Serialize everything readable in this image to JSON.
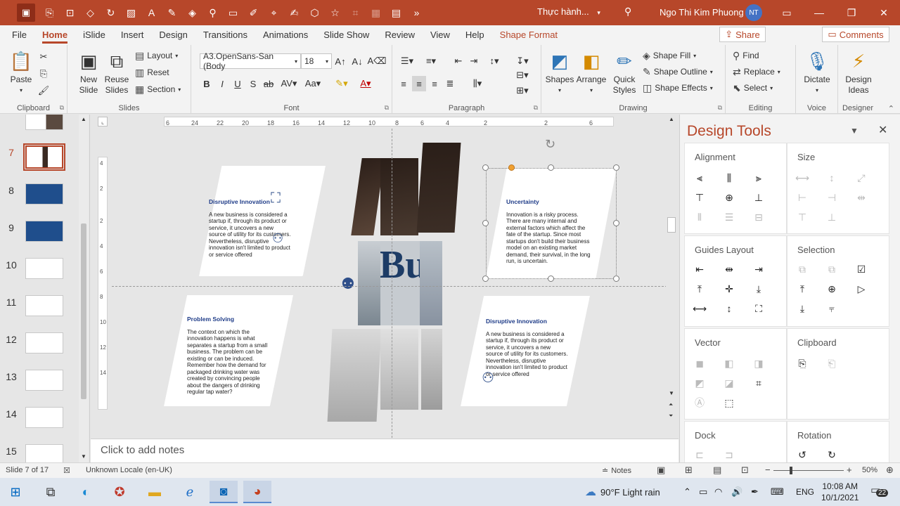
{
  "titlebar": {
    "doc_title": "Thực hành...",
    "user_name": "Ngo Thi Kim Phuong",
    "user_initials": "NT",
    "accent_color": "#b7472a"
  },
  "tabs": [
    "File",
    "Home",
    "iSlide",
    "Insert",
    "Design",
    "Transitions",
    "Animations",
    "Slide Show",
    "Review",
    "View",
    "Help",
    "Shape Format"
  ],
  "active_tab": "Home",
  "share_label": "Share",
  "comments_label": "Comments",
  "ribbon": {
    "clipboard": {
      "label": "Clipboard",
      "paste": "Paste"
    },
    "slides": {
      "label": "Slides",
      "new_slide": "New Slide",
      "reuse_slides": "Reuse Slides",
      "layout": "Layout",
      "reset": "Reset",
      "section": "Section"
    },
    "font": {
      "label": "Font",
      "font_name": "A3.OpenSans-San (Body",
      "font_size": "18"
    },
    "paragraph": {
      "label": "Paragraph"
    },
    "drawing": {
      "label": "Drawing",
      "shapes": "Shapes",
      "arrange": "Arrange",
      "quick_styles": "Quick Styles",
      "shape_fill": "Shape Fill",
      "shape_outline": "Shape Outline",
      "shape_effects": "Shape Effects"
    },
    "editing": {
      "label": "Editing",
      "find": "Find",
      "replace": "Replace",
      "select": "Select"
    },
    "voice": {
      "label": "Voice",
      "dictate": "Dictate"
    },
    "designer": {
      "label": "Designer",
      "design_ideas": "Design Ideas"
    }
  },
  "thumbnails": [
    {
      "num": "7",
      "selected": true
    },
    {
      "num": "8"
    },
    {
      "num": "9"
    },
    {
      "num": "10"
    },
    {
      "num": "11"
    },
    {
      "num": "12"
    },
    {
      "num": "13"
    },
    {
      "num": "14"
    },
    {
      "num": "15"
    }
  ],
  "slide": {
    "card1": {
      "title": "Disruptive Innovation",
      "body": "A new business is considered a startup if, through its product or service, it uncovers a new source of utility for its customers. Nevertheless, disruptive innovation isn't limited to product or service offered"
    },
    "card2": {
      "title": "Uncertainty",
      "body": "Innovation is a risky process. There are many internal and external factors which affect the fate of the startup. Since most startups don't build their business model on an existing market demand, their survival, in the long run, is uncertain."
    },
    "card3": {
      "title": "Problem Solving",
      "body": "The context on which the innovation happens is what separates a startup from a small business. The problem can be existing or can be induced. Remember how the demand for packaged drinking water was created by convincing people about the dangers of drinking regular tap water?"
    },
    "card4": {
      "title": "Disruptive Innovation",
      "body": "A new business is considered a startup if, through its product or service, it uncovers a new source of utility for its customers. Nevertheless, disruptive innovation isn't limited to product or service offered"
    },
    "photo_text": "Bu"
  },
  "notes_placeholder": "Click to add notes",
  "design_tools": {
    "title": "Design Tools",
    "sections": [
      "Alignment",
      "Size",
      "Guides Layout",
      "Selection",
      "Vector",
      "Clipboard",
      "Dock",
      "Rotation"
    ]
  },
  "statusbar": {
    "slide_info": "Slide 7 of 17",
    "locale": "Unknown Locale (en-UK)",
    "notes": "Notes",
    "zoom": "50%"
  },
  "taskbar": {
    "weather": "90°F  Light rain",
    "lang": "ENG",
    "time": "10:08 AM",
    "date": "10/1/2021",
    "notif_count": "22"
  }
}
